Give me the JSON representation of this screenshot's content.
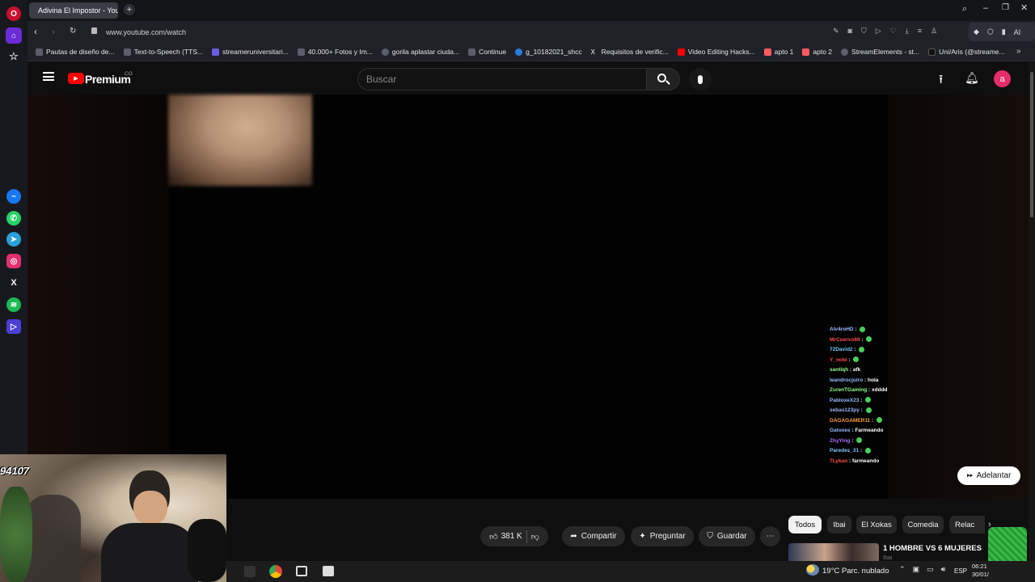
{
  "tab": {
    "title": "Adivina El Impostor - You"
  },
  "address": {
    "url": "www.youtube.com/watch"
  },
  "bookmarks": [
    "Pautas de diseño de...",
    "Text-to-Speech (TTS...",
    "streameruniversitari...",
    "40.000+ Fotos y Im...",
    "gorila aplastar ciuda...",
    "Continue",
    "g_10182021_shcc",
    "Requisitos de verific...",
    "Video Editing Hacks...",
    "apto 1",
    "apto 2",
    "StreamElements - st...",
    "Uni/Aris (@streame..."
  ],
  "toolbar": {
    "ai_label": "AI"
  },
  "youtube": {
    "logo_text": "Premium",
    "country": "CO",
    "search_placeholder": "Buscar",
    "avatar_letter": "a"
  },
  "chat": [
    {
      "user": "Alv4roHD",
      "msg": "",
      "color": "#9ab8ff",
      "emote": true
    },
    {
      "user": "MrCuervo69",
      "msg": "",
      "color": "#ff4b4b",
      "emote": true
    },
    {
      "user": "72David2",
      "msg": "",
      "color": "#7ac7ff",
      "emote": true
    },
    {
      "user": "Y_nobi",
      "msg": "",
      "color": "#ff4b4b",
      "emote": true
    },
    {
      "user": "santiqh",
      "msg": "afk",
      "color": "#8cff8c",
      "emote": false
    },
    {
      "user": "leandrocjuiro",
      "msg": "hola",
      "color": "#9ab8ff",
      "emote": false
    },
    {
      "user": "ZurenTGaming",
      "msg": "xdddd",
      "color": "#8cff8c",
      "emote": false
    },
    {
      "user": "PabloxeX23",
      "msg": "",
      "color": "#9ab8ff",
      "emote": true
    },
    {
      "user": "sebas123py",
      "msg": "",
      "color": "#9ab8ff",
      "emote": true
    },
    {
      "user": "DAGAGAMER11",
      "msg": "",
      "color": "#ff9a3c",
      "emote": true
    },
    {
      "user": "Gatoxes",
      "msg": "Farmeando",
      "color": "#9ab8ff",
      "emote": false
    },
    {
      "user": "ZhyYing",
      "msg": "",
      "color": "#b06cff",
      "emote": true
    },
    {
      "user": "Paredes_31",
      "msg": "",
      "color": "#7ac7ff",
      "emote": true
    },
    {
      "user": "7Lykan",
      "msg": "farmeando",
      "color": "#ff4b4b",
      "emote": false
    }
  ],
  "skip_label": "Adelantar",
  "actions": {
    "likes": "381 K",
    "share": "Compartir",
    "ask": "Preguntar",
    "save": "Guardar"
  },
  "chips": [
    "Todos",
    "Ibai",
    "El Xokas",
    "Comedia",
    "Relac"
  ],
  "related": {
    "title": "1 HOMBRE VS 6 MUJERES",
    "channel": "Ibai"
  },
  "overlay": {
    "counter": "94107"
  },
  "taskbar": {
    "weather": "19°C  Parc. nublado",
    "lang": "ESP",
    "time": "06:21",
    "date": "30/01/"
  }
}
